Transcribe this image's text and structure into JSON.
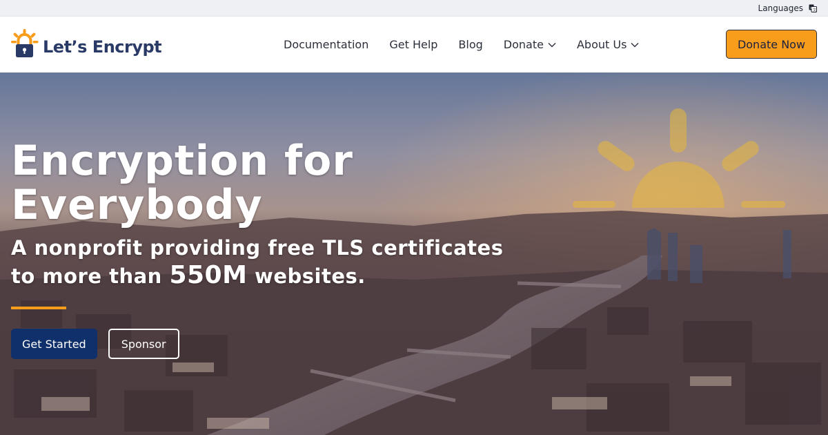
{
  "utility": {
    "languages_label": "Languages",
    "languages_icon": "translate-icon"
  },
  "header": {
    "logo_text": "Let’s Encrypt",
    "nav": {
      "documentation": "Documentation",
      "get_help": "Get Help",
      "blog": "Blog",
      "donate": "Donate",
      "about_us": "About Us"
    },
    "donate_now": "Donate Now"
  },
  "hero": {
    "title": "Encryption for Everybody",
    "subtitle_part1": "A nonprofit providing free TLS certificates to more than",
    "subtitle_number": "550M",
    "subtitle_part2": "websites.",
    "primary_button": "Get Started",
    "secondary_button": "Sponsor"
  },
  "colors": {
    "brand_orange": "#f89c1c",
    "brand_navy": "#10306b",
    "logo_navy": "#2a3a66",
    "utility_bg": "#eef0f4"
  }
}
